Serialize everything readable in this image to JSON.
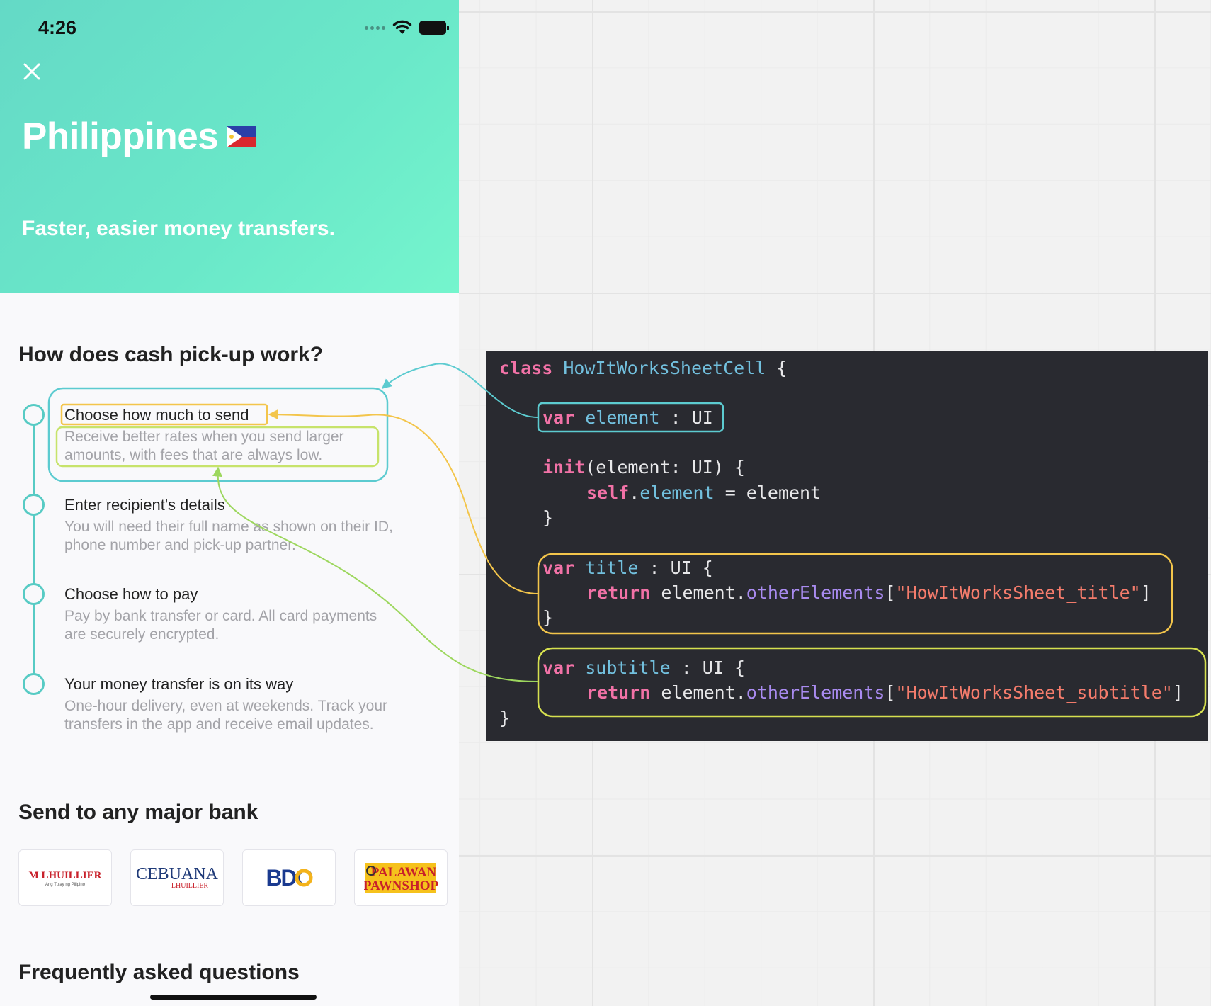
{
  "status_bar": {
    "time": "4:26"
  },
  "hero": {
    "title": "Philippines",
    "subtitle": "Faster, easier money transfers."
  },
  "how_it_works": {
    "title": "How does cash pick-up work?",
    "steps": [
      {
        "title": "Choose how much to send",
        "desc1": "Receive better rates when you send larger",
        "desc2": "amounts, with fees that are always low."
      },
      {
        "title": "Enter recipient's details",
        "desc1": "You will need their full name as shown on their ID,",
        "desc2": "phone number and pick-up partner."
      },
      {
        "title": "Choose how to pay",
        "desc1": "Pay by bank transfer or card. All card payments",
        "desc2": "are securely encrypted."
      },
      {
        "title": "Your money transfer is on its way",
        "desc1": "One-hour delivery, even at weekends. Track your",
        "desc2": "transfers in the app and receive email updates."
      }
    ]
  },
  "banks": {
    "title": "Send to any major bank",
    "items": [
      {
        "name": "M LHUILLIER",
        "tagline": "Ang Tulay ng Pilipino"
      },
      {
        "name": "CEBUANA",
        "tagline": "LHUILLIER"
      },
      {
        "name": "BDO",
        "tagline": ""
      },
      {
        "name": "PALAWAN",
        "tagline": "PAWNSHOP"
      }
    ]
  },
  "faq": {
    "title": "Frequently asked questions"
  },
  "code": {
    "l1_kw": "class",
    "l1_type": "HowItWorksSheetCell",
    "l1_end": " {",
    "l2_kw": "var",
    "l2_name": "element",
    "l2_rest": " : UI",
    "l3_kw": "init",
    "l3_rest": "(element: UI) {",
    "l4_kw": "self",
    "l4_dot": ".",
    "l4_prop": "element",
    "l4_rest": " = element",
    "l5": "}",
    "l6_kw": "var",
    "l6_name": "title",
    "l6_rest": " : UI {",
    "l7_kw": "return",
    "l7_a": " element.",
    "l7_m": "otherElements",
    "l7_b": "[",
    "l7_s": "\"HowItWorksSheet_title\"",
    "l7_c": "]",
    "l8": "}",
    "l9_kw": "var",
    "l9_name": "subtitle",
    "l9_rest": " : UI {",
    "l10_kw": "return",
    "l10_a": " element.",
    "l10_m": "otherElements",
    "l10_b": "[",
    "l10_s": "\"HowItWorksSheet_subtitle\"",
    "l10_c": "]",
    "l11": "}"
  },
  "colors": {
    "hero_start": "#64d9c6",
    "hero_end": "#75f5cd",
    "timeline": "#57cbc4",
    "link_teal": "#5ccbd0",
    "link_orange": "#f3c54b",
    "link_green": "#9dd75e",
    "code_bg": "#292a30",
    "keyword": "#f272a7",
    "type": "#72c0de",
    "method": "#a98bf0",
    "string": "#f57c6c"
  }
}
